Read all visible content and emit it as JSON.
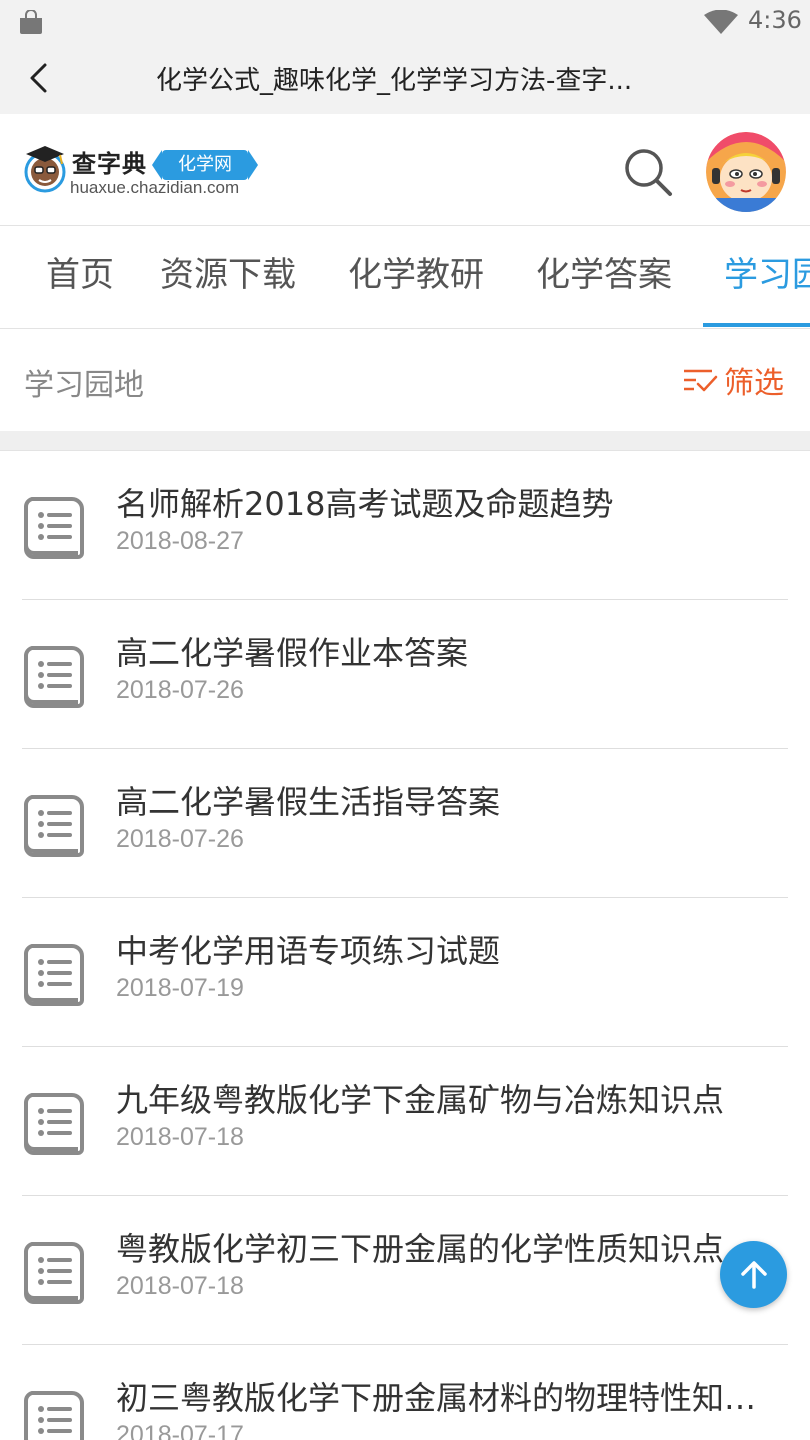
{
  "status_bar": {
    "time": "4:36"
  },
  "title_bar": {
    "title": "化学公式_趣味化学_化学学习方法-查字..."
  },
  "logo": {
    "name": "查字典",
    "tag": "化学网",
    "domain": "huaxue.chazidian.com"
  },
  "nav": {
    "tabs": [
      {
        "label": "首页",
        "active": false
      },
      {
        "label": "资源下载",
        "active": false
      },
      {
        "label": "化学教研",
        "active": false
      },
      {
        "label": "化学答案",
        "active": false
      },
      {
        "label": "学习园地",
        "active": true
      }
    ]
  },
  "section": {
    "title": "学习园地",
    "filter_label": "筛选"
  },
  "articles": [
    {
      "title": "名师解析2018高考试题及命题趋势",
      "date": "2018-08-27"
    },
    {
      "title": "高二化学暑假作业本答案",
      "date": "2018-07-26"
    },
    {
      "title": "高二化学暑假生活指导答案",
      "date": "2018-07-26"
    },
    {
      "title": "中考化学用语专项练习试题",
      "date": "2018-07-19"
    },
    {
      "title": "九年级粤教版化学下金属矿物与冶炼知识点",
      "date": "2018-07-18"
    },
    {
      "title": "粤教版化学初三下册金属的化学性质知识点",
      "date": "2018-07-18"
    },
    {
      "title": "初三粤教版化学下册金属材料的物理特性知识点",
      "date": "2018-07-17"
    }
  ],
  "colors": {
    "accent": "#2b9be0",
    "filter": "#ec5f2b",
    "text": "#333333",
    "muted": "#999999"
  },
  "icons": {
    "back": "chevron-left-icon",
    "search": "search-icon",
    "filter": "filter-check-icon",
    "document": "document-list-icon",
    "scroll_top": "arrow-up-icon"
  }
}
